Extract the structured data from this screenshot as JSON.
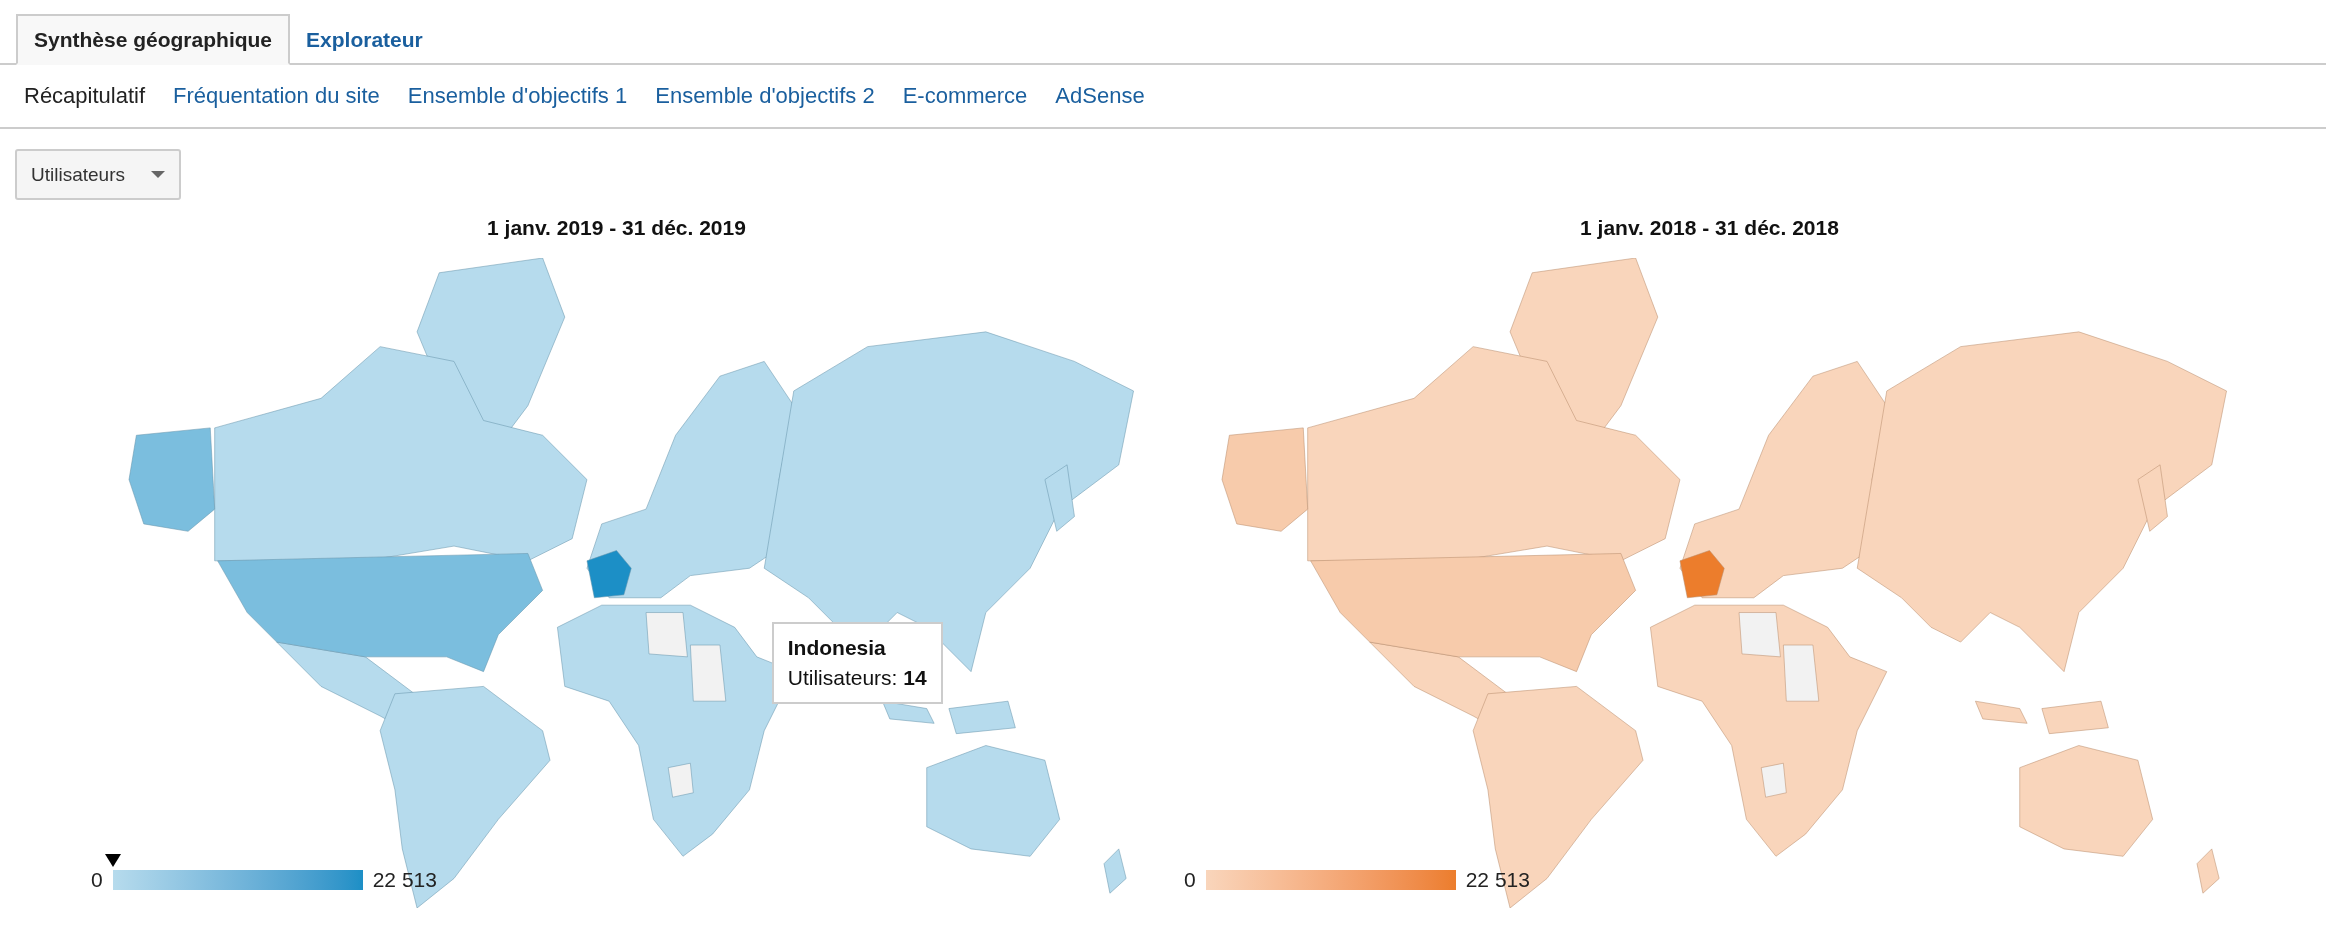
{
  "tabs": [
    {
      "label": "Synthèse géographique",
      "selected": true
    },
    {
      "label": "Explorateur",
      "selected": false
    }
  ],
  "subnav": [
    {
      "label": "Récapitulatif",
      "selected": true
    },
    {
      "label": "Fréquentation du site",
      "selected": false
    },
    {
      "label": "Ensemble d'objectifs 1",
      "selected": false
    },
    {
      "label": "Ensemble d'objectifs 2",
      "selected": false
    },
    {
      "label": "E-commerce",
      "selected": false
    },
    {
      "label": "AdSense",
      "selected": false
    }
  ],
  "metric_dropdown": {
    "value": "Utilisateurs"
  },
  "maps": [
    {
      "title": "1 janv. 2019 - 31 déc. 2019",
      "color": "#1c8fc6",
      "legend": {
        "min": "0",
        "max": "22 513",
        "level": 0
      },
      "tooltip": {
        "country": "Indonesia",
        "label": "Utilisateurs:",
        "value": "14"
      }
    },
    {
      "title": "1 janv. 2018 - 31 déc. 2018",
      "color": "#ec7d2c",
      "legend": {
        "min": "0",
        "max": "22 513"
      }
    }
  ]
}
